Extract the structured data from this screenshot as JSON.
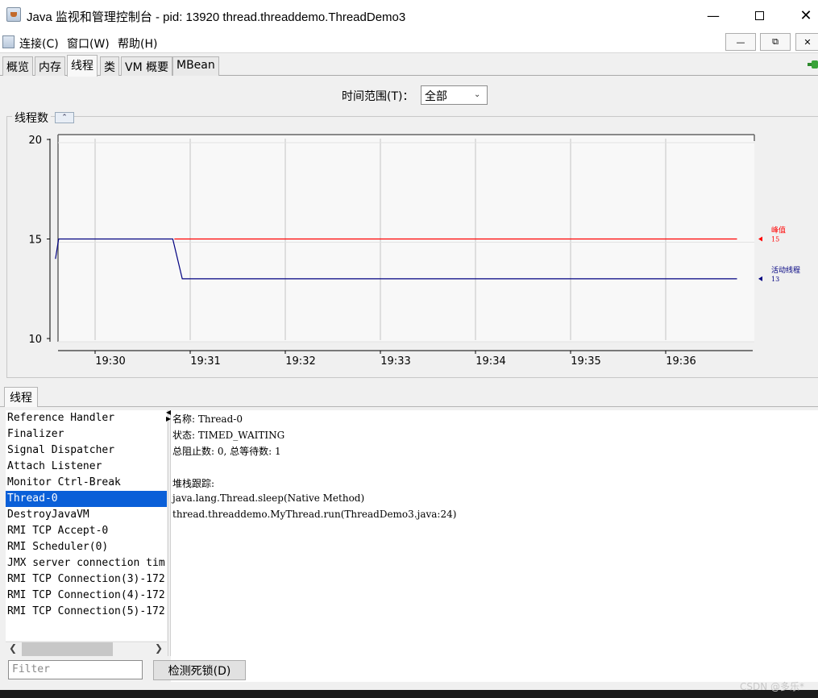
{
  "window": {
    "title": "Java 监视和管理控制台 - pid: 13920 thread.threaddemo.ThreadDemo3"
  },
  "menu": {
    "items": [
      {
        "label": "连接(C)"
      },
      {
        "label": "窗口(W)"
      },
      {
        "label": "帮助(H)"
      }
    ]
  },
  "tabs": [
    {
      "label": "概览"
    },
    {
      "label": "内存"
    },
    {
      "label": "线程",
      "active": true
    },
    {
      "label": "类"
    },
    {
      "label": "VM 概要"
    },
    {
      "label": "MBean"
    }
  ],
  "time_range": {
    "label": "时间范围(T)：",
    "selected": "全部"
  },
  "chart_panel": {
    "title": "线程数"
  },
  "chart_data": {
    "type": "line",
    "x_ticks": [
      "19:30",
      "19:31",
      "19:32",
      "19:33",
      "19:34",
      "19:35",
      "19:36"
    ],
    "y_ticks": [
      10,
      15,
      20
    ],
    "ylim": [
      10,
      20
    ],
    "grid": true,
    "legend_placement": "right",
    "series": [
      {
        "name": "峰值",
        "color": "#ff0000",
        "last_value": "15",
        "points": [
          [
            "19:30:50",
            15
          ],
          [
            "19:36:45",
            15
          ]
        ]
      },
      {
        "name": "活动线程",
        "color": "#000080",
        "last_value": "13",
        "points": [
          [
            "19:29:35",
            14
          ],
          [
            "19:29:37",
            15
          ],
          [
            "19:30:49",
            15
          ],
          [
            "19:30:55",
            13
          ],
          [
            "19:36:45",
            13
          ]
        ]
      }
    ]
  },
  "lower_tab": {
    "label": "线程"
  },
  "threads": [
    "Reference Handler",
    "Finalizer",
    "Signal Dispatcher",
    "Attach Listener",
    "Monitor Ctrl-Break",
    "Thread-0",
    "DestroyJavaVM",
    "RMI TCP Accept-0",
    "RMI Scheduler(0)",
    "JMX server connection tim",
    "RMI TCP Connection(3)-172",
    "RMI TCP Connection(4)-172",
    "RMI TCP Connection(5)-172"
  ],
  "selected_thread": "Thread-0",
  "details": {
    "lines": [
      "名称: Thread-0",
      "状态: TIMED_WAITING",
      "总阻止数: 0, 总等待数: 1",
      "",
      "堆栈跟踪:",
      "java.lang.Thread.sleep(Native Method)",
      "thread.threaddemo.MyThread.run(ThreadDemo3.java:24)"
    ]
  },
  "filter": {
    "placeholder": "Filter"
  },
  "deadlock_button": {
    "label": "检测死锁(D)"
  },
  "watermark": "CSDN @多乐*"
}
